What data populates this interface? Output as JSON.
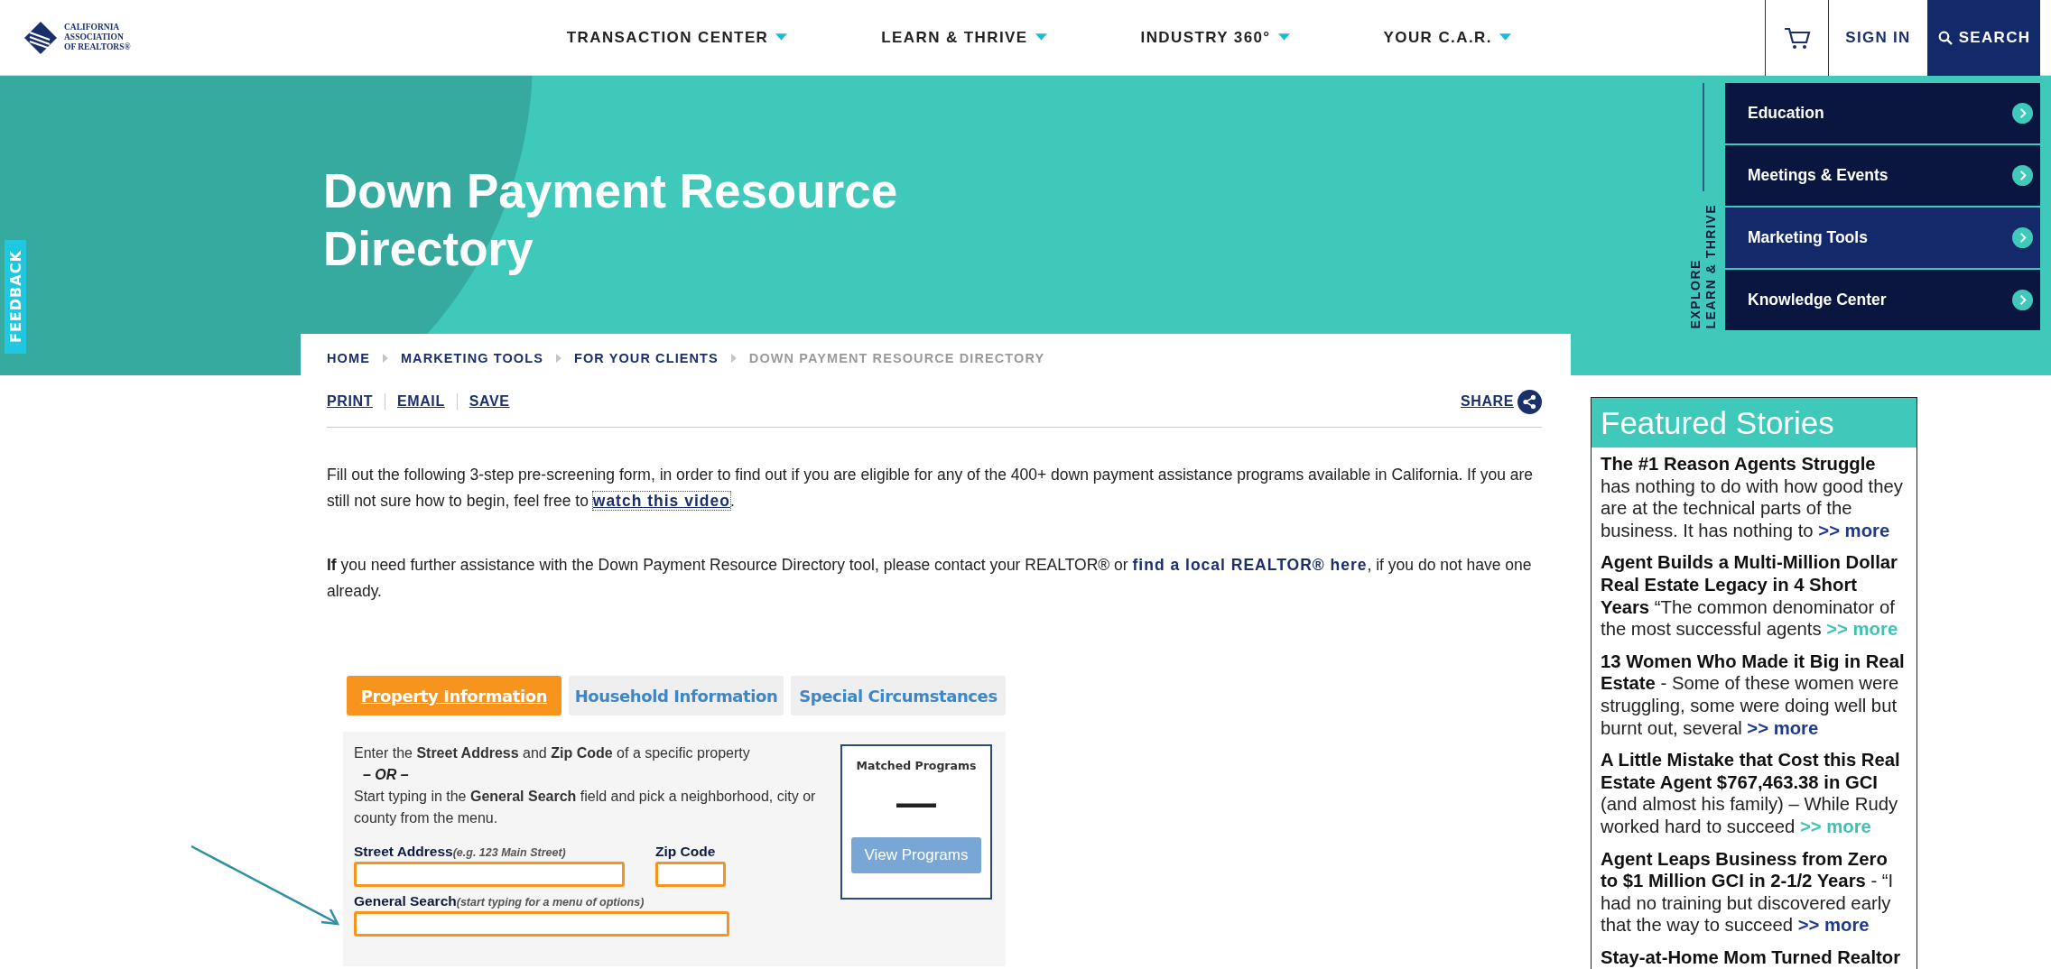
{
  "header": {
    "logo_lines": [
      "CALIFORNIA",
      "ASSOCIATION",
      "OF REALTORS®"
    ],
    "nav": [
      {
        "label": "TRANSACTION CENTER"
      },
      {
        "label": "LEARN & THRIVE"
      },
      {
        "label": "INDUSTRY 360°"
      },
      {
        "label": "YOUR C.A.R."
      }
    ],
    "sign_in": "SIGN IN",
    "search": "SEARCH"
  },
  "feedback": "FEEDBACK",
  "hero": {
    "title": "Down Payment Resource Directory",
    "explore_lines": [
      "EXPLORE",
      "LEARN & THRIVE"
    ],
    "menu": [
      {
        "label": "Education",
        "selected": false
      },
      {
        "label": "Meetings & Events",
        "selected": false
      },
      {
        "label": "Marketing Tools",
        "selected": true
      },
      {
        "label": "Knowledge Center",
        "selected": false
      }
    ]
  },
  "breadcrumbs": [
    {
      "label": "HOME",
      "current": false
    },
    {
      "label": "MARKETING TOOLS",
      "current": false
    },
    {
      "label": "FOR YOUR CLIENTS",
      "current": false
    },
    {
      "label": "DOWN PAYMENT RESOURCE DIRECTORY",
      "current": true
    }
  ],
  "actions": [
    "PRINT",
    "EMAIL",
    "SAVE"
  ],
  "share": "SHARE",
  "intro": {
    "text": "Fill out the following 3-step pre-screening form, in order to find out if you are eligible for any of the 400+ down payment assistance programs available in California. If you are still not sure how to begin, feel free to",
    "link": "watch this video",
    "after": "."
  },
  "help": {
    "text": "**If** you need further assistance with the Down Payment Resource Directory tool, please contact your REALTOR® or",
    "link": "find a local REALTOR® here",
    "after": ", if you do not have one already."
  },
  "form": {
    "tabs": [
      {
        "label": "Property Information",
        "selected": true
      },
      {
        "label": "Household Information",
        "selected": false
      },
      {
        "label": "Special Circumstances",
        "selected": false
      }
    ],
    "instructions": [
      {
        "kind": "text",
        "text": "Enter the **Street Address** and **Zip Code** of a specific property"
      },
      {
        "kind": "separator",
        "text": "– OR –"
      },
      {
        "kind": "text",
        "text": "Start typing in the **General Search** field and pick a neighborhood, city or county from the menu."
      }
    ],
    "field_rows": [
      [
        {
          "label": "Street Address",
          "hint": "(e.g. 123 Main Street)",
          "kind": "wide"
        },
        {
          "label": "Zip Code",
          "kind": "short"
        }
      ],
      [
        {
          "label": "General Search",
          "hint": "(start typing for a menu of options)",
          "kind": "long"
        }
      ]
    ],
    "matched": {
      "title": "Matched Programs",
      "count": "—",
      "button": "View Programs"
    }
  },
  "featured": {
    "title": "Featured Stories",
    "stories": [
      {
        "title": "The #1 Reason Agents Struggle",
        "text": "has nothing to do with how good they are at the technical parts of the business. It has nothing to",
        "more": ">> more",
        "color": "#1f3a8a"
      },
      {
        "title": "Agent Builds a Multi-Million Dollar Real Estate Legacy in 4 Short Years",
        "text": " “The common denominator of the most successful agents",
        "more": ">> more",
        "color": "#3ec2b4"
      },
      {
        "title": "13 Women Who Made it Big in Real Estate",
        "text": "- Some of these women were struggling, some were doing well but burnt out, several",
        "more": ">> more",
        "color": "#1f3a8a"
      },
      {
        "title": "A Little Mistake that Cost this Real Estate Agent $767,463.38 in GCI",
        "text": "(and almost his family) – While Rudy worked hard to succeed",
        "more": ">> more",
        "color": "#3ec2b4"
      },
      {
        "title": "Agent Leaps Business from Zero to $1 Million GCI in 2-1/2 Years",
        "text": "- “I had no training but discovered early that the way to succeed",
        "more": ">> more",
        "color": "#1f3a8a"
      },
      {
        "title": "Stay-at-Home Mom Turned Realtor"
      }
    ]
  }
}
